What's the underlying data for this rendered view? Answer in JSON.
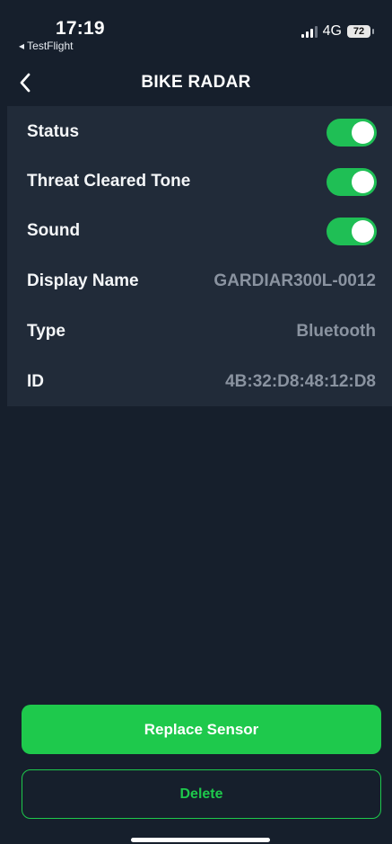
{
  "status_bar": {
    "time": "17:19",
    "back_app": "◂ TestFlight",
    "network": "4G",
    "battery": "72"
  },
  "nav": {
    "title": "BIKE RADAR",
    "back_icon": "chevron-left-icon"
  },
  "settings": {
    "toggles": [
      {
        "label": "Status",
        "on": true
      },
      {
        "label": "Threat Cleared Tone",
        "on": true
      },
      {
        "label": "Sound",
        "on": true
      }
    ],
    "info": [
      {
        "label": "Display Name",
        "value": "GARDIAR300L-0012"
      },
      {
        "label": "Type",
        "value": "Bluetooth"
      },
      {
        "label": "ID",
        "value": "4B:32:D8:48:12:D8"
      }
    ]
  },
  "actions": {
    "replace_label": "Replace Sensor",
    "delete_label": "Delete"
  },
  "colors": {
    "background": "#161f2c",
    "panel": "#212b39",
    "accent_green": "#1ec94c",
    "muted_value": "#8a93a0"
  }
}
